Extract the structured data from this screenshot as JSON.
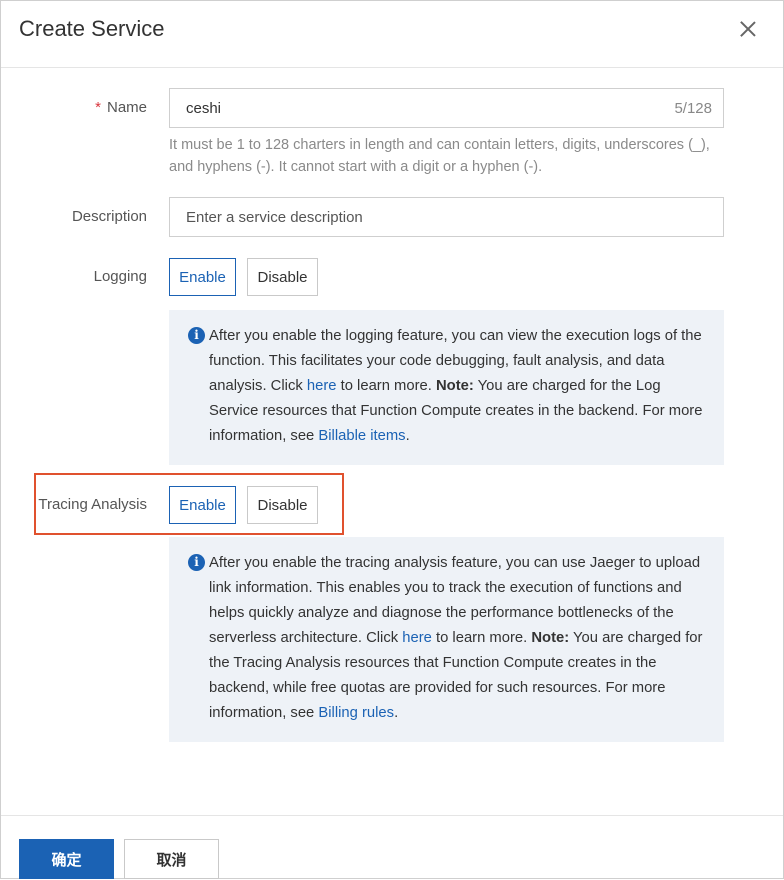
{
  "dialog": {
    "title": "Create Service"
  },
  "form": {
    "name": {
      "required_mark": "*",
      "label": "Name",
      "value": "ceshi",
      "counter": "5/128",
      "hint": "It must be 1 to 128 charters in length and can contain letters, digits, underscores (_), and hyphens (-). It cannot start with a digit or a hyphen (-)."
    },
    "description": {
      "label": "Description",
      "placeholder": "Enter a service description"
    },
    "logging": {
      "label": "Logging",
      "enable_label": "Enable",
      "disable_label": "Disable",
      "selected": "Enable",
      "info": {
        "text1": "After you enable the logging feature, you can view the execution logs of the function. This facilitates your code debugging, fault analysis, and data analysis. Click ",
        "link1": "here",
        "text2": " to learn more. ",
        "note_label": "Note:",
        "text3": " You are charged for the Log Service resources that Function Compute creates in the backend. For more information, see ",
        "link2": "Billable items",
        "text4": "."
      }
    },
    "tracing": {
      "label": "Tracing Analysis",
      "enable_label": "Enable",
      "disable_label": "Disable",
      "selected": "Enable",
      "info": {
        "text1": "After you enable the tracing analysis feature, you can use Jaeger to upload link information. This enables you to track the execution of functions and helps quickly analyze and diagnose the performance bottlenecks of the serverless architecture. Click ",
        "link1": "here",
        "text2": " to learn more. ",
        "note_label": "Note:",
        "text3": " You are charged for the Tracing Analysis resources that Function Compute creates in the backend, while free quotas are provided for such resources. For more information, see ",
        "link2": "Billing rules",
        "text4": "."
      }
    }
  },
  "footer": {
    "confirm_label": "确定",
    "cancel_label": "取消"
  },
  "colors": {
    "accent": "#1b62b4",
    "highlight_border": "#e0512e",
    "info_background": "#eef2f7"
  },
  "icons": {
    "close": "close-icon",
    "info": "info-icon"
  }
}
